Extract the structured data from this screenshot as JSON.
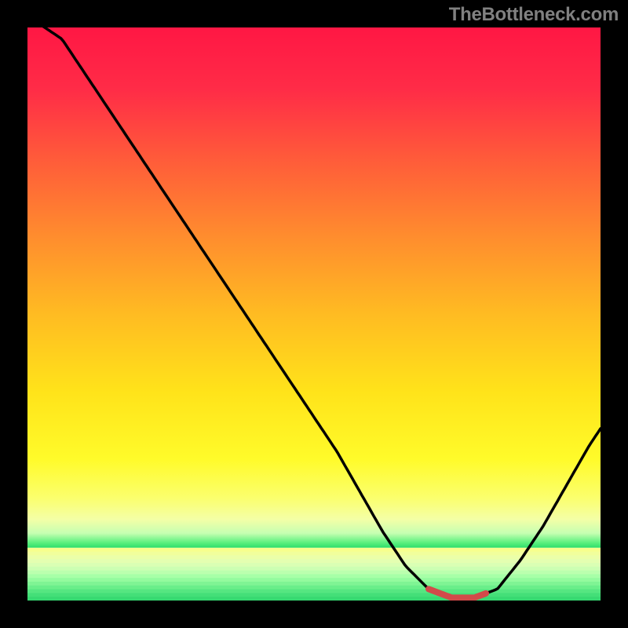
{
  "watermark": "TheBottleneck.com",
  "chart_data": {
    "type": "line",
    "title": "",
    "xlabel": "",
    "ylabel": "",
    "xlim": [
      0,
      100
    ],
    "ylim": [
      0,
      100
    ],
    "x": [
      0,
      6,
      12,
      18,
      24,
      30,
      36,
      42,
      48,
      54,
      58,
      62,
      66,
      70,
      74,
      78,
      82,
      86,
      90,
      94,
      98,
      100
    ],
    "values": [
      102,
      98,
      89,
      80,
      71,
      62,
      53,
      44,
      35,
      26,
      19,
      12,
      6,
      2,
      0.5,
      0.5,
      2,
      7,
      13,
      20,
      27,
      30
    ],
    "flat_zone_x": [
      70,
      80
    ],
    "annotations": [],
    "gradient_stops": [
      {
        "offset": 0.0,
        "color": "#ff1744"
      },
      {
        "offset": 0.12,
        "color": "#ff2c47"
      },
      {
        "offset": 0.25,
        "color": "#ff5a3a"
      },
      {
        "offset": 0.4,
        "color": "#ff8c2e"
      },
      {
        "offset": 0.55,
        "color": "#ffbb22"
      },
      {
        "offset": 0.7,
        "color": "#ffe31a"
      },
      {
        "offset": 0.83,
        "color": "#fffb2a"
      },
      {
        "offset": 0.905,
        "color": "#fbff6e"
      },
      {
        "offset": 0.945,
        "color": "#f4ffa6"
      },
      {
        "offset": 0.972,
        "color": "#c6ffb2"
      },
      {
        "offset": 0.99,
        "color": "#5cf07e"
      },
      {
        "offset": 1.0,
        "color": "#2edd6a"
      }
    ],
    "stripe_colors": [
      "#f7ff8e",
      "#f1ff9c",
      "#ebffa9",
      "#e4ffb1",
      "#daffb4",
      "#ccffb3",
      "#bbffae",
      "#a7ffa7",
      "#93fb9e",
      "#7ff494",
      "#6aee8a",
      "#56e681",
      "#44df78",
      "#37d971"
    ]
  },
  "colors": {
    "background": "#000000",
    "curve": "#000000",
    "flat_highlight": "#d24a4a"
  }
}
